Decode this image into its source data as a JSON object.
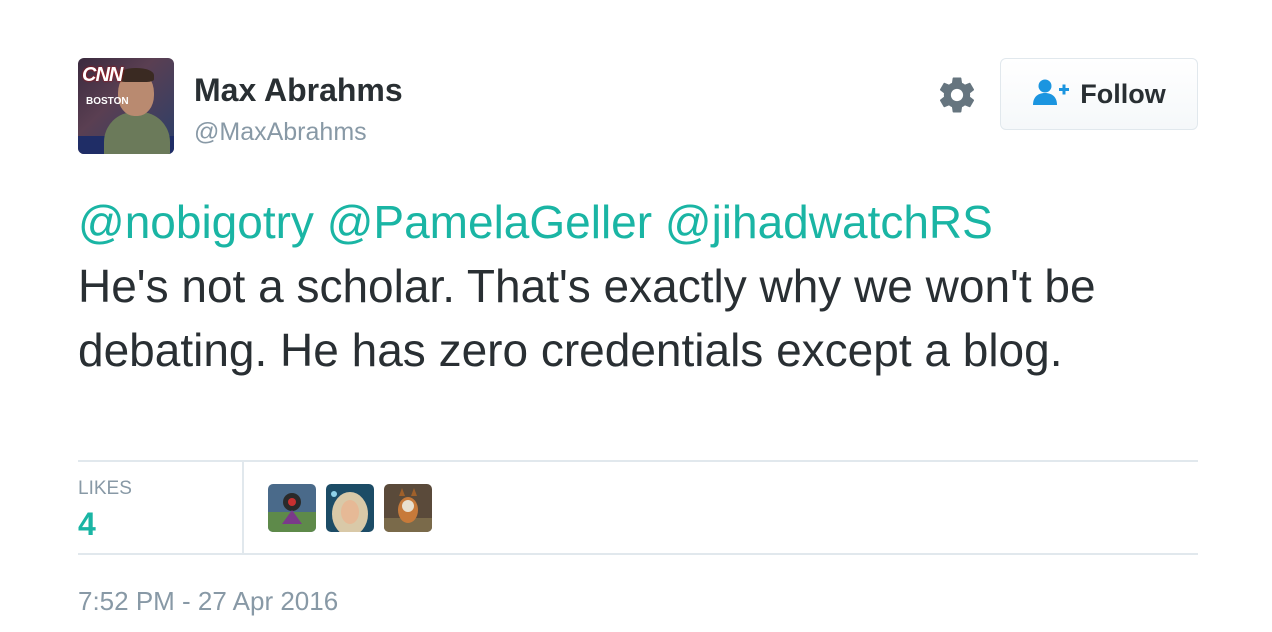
{
  "author": {
    "name": "Max Abrahms",
    "handle": "@MaxAbrahms",
    "avatar_text": {
      "network": "CNN",
      "city": "BOSTON"
    }
  },
  "header": {
    "follow_label": "Follow",
    "settings_icon": "gear-icon",
    "follow_icon": "add-user-icon"
  },
  "tweet": {
    "mentions": [
      "@nobigotry",
      "@PamelaGeller",
      "@jihadwatchRS"
    ],
    "text": "He's not a scholar. That's exactly why we won't be debating. He has zero credentials except a blog."
  },
  "stats": {
    "likes_label": "LIKES",
    "likes_count": "4"
  },
  "timestamp": "7:52 PM - 27 Apr 2016",
  "colors": {
    "accent": "#1ab5a4",
    "text": "#292f33",
    "muted": "#8899a6",
    "border": "#e1e8ed"
  }
}
